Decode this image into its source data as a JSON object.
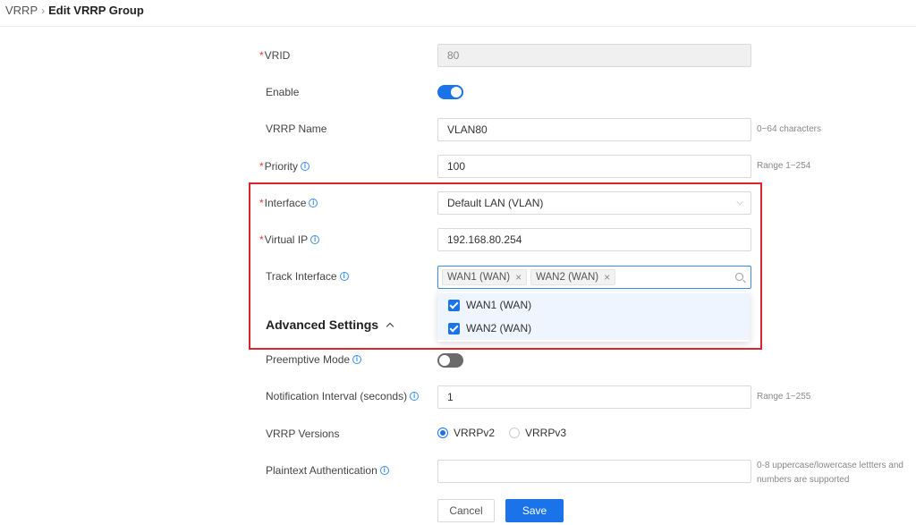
{
  "breadcrumb": {
    "parent": "VRRP",
    "separator": "›",
    "current": "Edit VRRP Group"
  },
  "form": {
    "vrid": {
      "label": "VRID",
      "value": "80"
    },
    "enable": {
      "label": "Enable",
      "state": "on"
    },
    "vrrp_name": {
      "label": "VRRP Name",
      "value": "VLAN80",
      "hint": "0~64 characters"
    },
    "priority": {
      "label": "Priority",
      "value": "100",
      "hint": "Range 1~254"
    },
    "interface": {
      "label": "Interface",
      "value": "Default LAN (VLAN)"
    },
    "virtual_ip": {
      "label": "Virtual IP",
      "value": "192.168.80.254"
    },
    "track_interface": {
      "label": "Track Interface",
      "tags": [
        "WAN1 (WAN)",
        "WAN2 (WAN)"
      ],
      "options": [
        {
          "label": "WAN1 (WAN)",
          "checked": true
        },
        {
          "label": "WAN2 (WAN)",
          "checked": true
        }
      ]
    },
    "advanced_settings": {
      "label": "Advanced Settings"
    },
    "preemptive_mode": {
      "label": "Preemptive Mode",
      "state": "off"
    },
    "notification_interval": {
      "label": "Notification Interval (seconds)",
      "value": "1",
      "hint": "Range 1~255"
    },
    "vrrp_versions": {
      "label": "VRRP Versions",
      "options": [
        "VRRPv2",
        "VRRPv3"
      ],
      "selected": "VRRPv2"
    },
    "plaintext_auth": {
      "label": "Plaintext Authentication",
      "value": "",
      "hint_line1": "0-8 uppercase/lowercase lettters and",
      "hint_line2": "numbers are supported"
    }
  },
  "buttons": {
    "cancel": "Cancel",
    "save": "Save"
  },
  "colors": {
    "accent": "#1a73e8",
    "required": "#e53935",
    "highlight_box": "#d9252b"
  }
}
